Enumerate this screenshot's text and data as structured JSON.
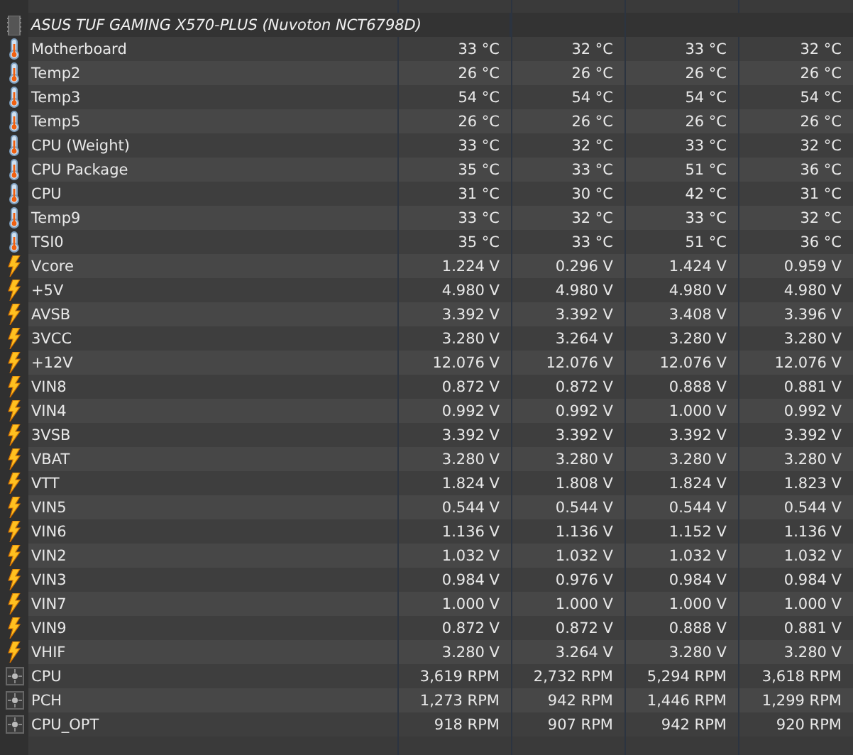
{
  "device": {
    "title": "ASUS TUF GAMING X570-PLUS (Nuvoton NCT6798D)"
  },
  "rows": [
    {
      "kind": "temp",
      "label": "Motherboard",
      "values": [
        "33 °C",
        "32 °C",
        "33 °C",
        "32 °C"
      ]
    },
    {
      "kind": "temp",
      "label": "Temp2",
      "values": [
        "26 °C",
        "26 °C",
        "26 °C",
        "26 °C"
      ]
    },
    {
      "kind": "temp",
      "label": "Temp3",
      "values": [
        "54 °C",
        "54 °C",
        "54 °C",
        "54 °C"
      ]
    },
    {
      "kind": "temp",
      "label": "Temp5",
      "values": [
        "26 °C",
        "26 °C",
        "26 °C",
        "26 °C"
      ]
    },
    {
      "kind": "temp",
      "label": "CPU (Weight)",
      "values": [
        "33 °C",
        "32 °C",
        "33 °C",
        "32 °C"
      ]
    },
    {
      "kind": "temp",
      "label": "CPU Package",
      "values": [
        "35 °C",
        "33 °C",
        "51 °C",
        "36 °C"
      ]
    },
    {
      "kind": "temp",
      "label": "CPU",
      "values": [
        "31 °C",
        "30 °C",
        "42 °C",
        "31 °C"
      ]
    },
    {
      "kind": "temp",
      "label": "Temp9",
      "values": [
        "33 °C",
        "32 °C",
        "33 °C",
        "32 °C"
      ]
    },
    {
      "kind": "temp",
      "label": "TSI0",
      "values": [
        "35 °C",
        "33 °C",
        "51 °C",
        "36 °C"
      ]
    },
    {
      "kind": "volt",
      "label": "Vcore",
      "values": [
        "1.224 V",
        "0.296 V",
        "1.424 V",
        "0.959 V"
      ]
    },
    {
      "kind": "volt",
      "label": "+5V",
      "values": [
        "4.980 V",
        "4.980 V",
        "4.980 V",
        "4.980 V"
      ]
    },
    {
      "kind": "volt",
      "label": "AVSB",
      "values": [
        "3.392 V",
        "3.392 V",
        "3.408 V",
        "3.396 V"
      ]
    },
    {
      "kind": "volt",
      "label": "3VCC",
      "values": [
        "3.280 V",
        "3.264 V",
        "3.280 V",
        "3.280 V"
      ]
    },
    {
      "kind": "volt",
      "label": "+12V",
      "values": [
        "12.076 V",
        "12.076 V",
        "12.076 V",
        "12.076 V"
      ]
    },
    {
      "kind": "volt",
      "label": "VIN8",
      "values": [
        "0.872 V",
        "0.872 V",
        "0.888 V",
        "0.881 V"
      ]
    },
    {
      "kind": "volt",
      "label": "VIN4",
      "values": [
        "0.992 V",
        "0.992 V",
        "1.000 V",
        "0.992 V"
      ]
    },
    {
      "kind": "volt",
      "label": "3VSB",
      "values": [
        "3.392 V",
        "3.392 V",
        "3.392 V",
        "3.392 V"
      ]
    },
    {
      "kind": "volt",
      "label": "VBAT",
      "values": [
        "3.280 V",
        "3.280 V",
        "3.280 V",
        "3.280 V"
      ]
    },
    {
      "kind": "volt",
      "label": "VTT",
      "values": [
        "1.824 V",
        "1.808 V",
        "1.824 V",
        "1.823 V"
      ]
    },
    {
      "kind": "volt",
      "label": "VIN5",
      "values": [
        "0.544 V",
        "0.544 V",
        "0.544 V",
        "0.544 V"
      ]
    },
    {
      "kind": "volt",
      "label": "VIN6",
      "values": [
        "1.136 V",
        "1.136 V",
        "1.152 V",
        "1.136 V"
      ]
    },
    {
      "kind": "volt",
      "label": "VIN2",
      "values": [
        "1.032 V",
        "1.032 V",
        "1.032 V",
        "1.032 V"
      ]
    },
    {
      "kind": "volt",
      "label": "VIN3",
      "values": [
        "0.984 V",
        "0.976 V",
        "0.984 V",
        "0.984 V"
      ]
    },
    {
      "kind": "volt",
      "label": "VIN7",
      "values": [
        "1.000 V",
        "1.000 V",
        "1.000 V",
        "1.000 V"
      ]
    },
    {
      "kind": "volt",
      "label": "VIN9",
      "values": [
        "0.872 V",
        "0.872 V",
        "0.888 V",
        "0.881 V"
      ]
    },
    {
      "kind": "volt",
      "label": "VHIF",
      "values": [
        "3.280 V",
        "3.264 V",
        "3.280 V",
        "3.280 V"
      ]
    },
    {
      "kind": "fan",
      "label": "CPU",
      "values": [
        "3,619 RPM",
        "2,732 RPM",
        "5,294 RPM",
        "3,618 RPM"
      ]
    },
    {
      "kind": "fan",
      "label": "PCH",
      "values": [
        "1,273 RPM",
        "942 RPM",
        "1,446 RPM",
        "1,299 RPM"
      ]
    },
    {
      "kind": "fan",
      "label": "CPU_OPT",
      "values": [
        "918 RPM",
        "907 RPM",
        "942 RPM",
        "920 RPM"
      ]
    }
  ]
}
